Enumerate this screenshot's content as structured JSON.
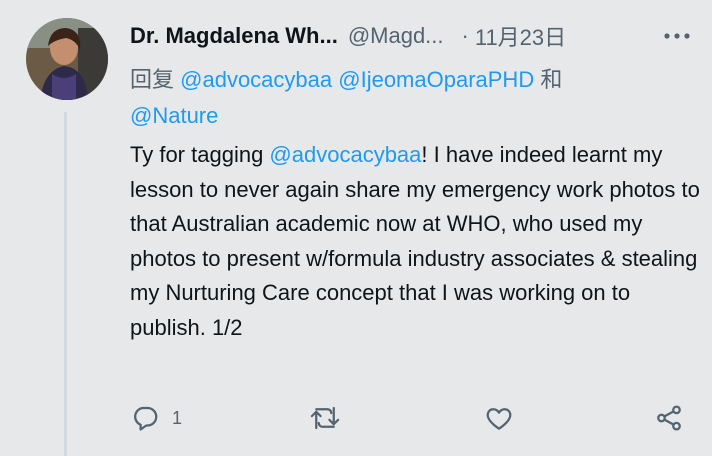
{
  "tweet": {
    "author_name": "Dr. Magdalena Wh...",
    "author_handle": "@Magd...",
    "separator": "·",
    "date": "11月23日",
    "reply_prefix": "回复",
    "reply_to": [
      "@advocacybaa",
      "@IjeomaOparaPHD"
    ],
    "reply_and": "和",
    "reply_to_last": "@Nature",
    "text_before_mention": "Ty for tagging ",
    "text_mention": "@advocacybaa",
    "text_after_mention": "! I have indeed learnt my lesson to never again share my emergency work photos to that Australian academic now at WHO, who used my photos to present w/formula industry associates & stealing my Nurturing Care concept that I was working on to publish. 1/2",
    "reply_count": "1",
    "more_icon": "more-horizontal-icon",
    "icons": {
      "reply": "reply-icon",
      "retweet": "retweet-icon",
      "like": "heart-icon",
      "share": "share-icon"
    },
    "colors": {
      "link": "#1d9bf0",
      "secondary_text": "#536471",
      "primary_text": "#0f1419",
      "background": "#e7e8e9"
    }
  }
}
